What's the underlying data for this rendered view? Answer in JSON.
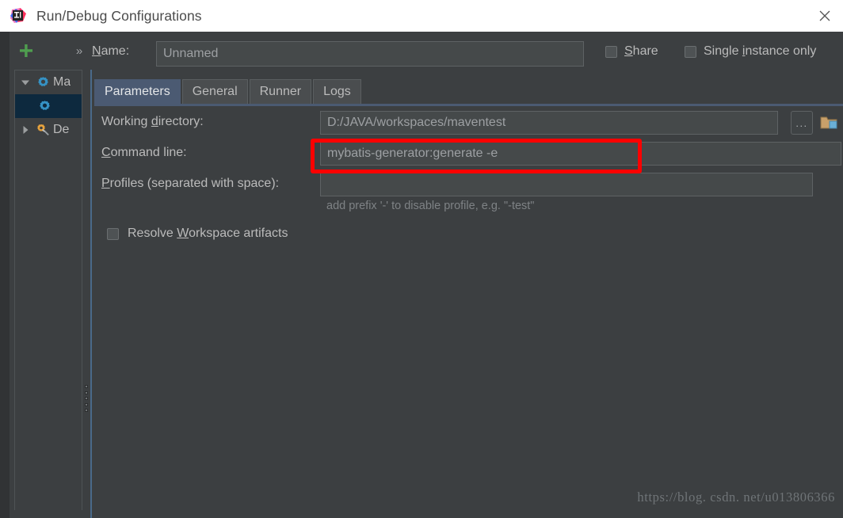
{
  "window": {
    "title": "Run/Debug Configurations",
    "logo_icon": "intellij-idea-logo",
    "close_icon": "close-icon"
  },
  "toolbar": {
    "add_icon": "plus-icon",
    "more_icon": "chevron-double-right-icon",
    "name_label_prefix": "N",
    "name_label_rest": "ame:",
    "name_value": "Unnamed",
    "name_placeholder": "Unnamed",
    "checkboxes": [
      {
        "id": "share",
        "label_prefix": "S",
        "label_rest": "hare",
        "checked": false
      },
      {
        "id": "single-instance",
        "label_prefix": "Single ",
        "label_mn": "i",
        "label_rest": "nstance only",
        "checked": false
      }
    ]
  },
  "sidebar": {
    "items": [
      {
        "id": "maven",
        "label": "Ma",
        "icon": "gear-icon",
        "twisty": "triangle-down-icon",
        "expanded": true,
        "selected": false,
        "indent": false
      },
      {
        "id": "maven-child",
        "label": "",
        "icon": "gear-icon",
        "twisty": "",
        "expanded": false,
        "selected": true,
        "indent": true
      },
      {
        "id": "defaults",
        "label": "De",
        "icon": "wrench-gear-icon",
        "twisty": "triangle-right-icon",
        "expanded": false,
        "selected": false,
        "indent": false
      }
    ],
    "splitter_handle": "splitter-dots"
  },
  "tabs": [
    {
      "id": "parameters",
      "label": "Parameters",
      "active": true
    },
    {
      "id": "general",
      "label": "General",
      "active": false
    },
    {
      "id": "runner",
      "label": "Runner",
      "active": false
    },
    {
      "id": "logs",
      "label": "Logs",
      "active": false
    }
  ],
  "form": {
    "working_directory": {
      "label_a": "Working ",
      "label_mn": "d",
      "label_b": "irectory:",
      "value": "D:/JAVA/workspaces/maventest",
      "browse_label": "...",
      "folder_icon": "folder-icon"
    },
    "command_line": {
      "label_mn": "C",
      "label_b": "ommand line:",
      "value": "mybatis-generator:generate -e"
    },
    "profiles": {
      "label_mn": "P",
      "label_b": "rofiles (separated with space):",
      "value": "",
      "hint": "add prefix '-' to disable profile, e.g. \"-test\""
    },
    "resolve_workspace": {
      "label_a": "Resolve ",
      "label_mn": "W",
      "label_b": "orkspace artifacts",
      "checked": false
    }
  },
  "annotation": {
    "color": "#fe0000",
    "target": "command-line-input"
  },
  "watermark": {
    "text": "https://blog. csdn. net/u013806366"
  },
  "colors": {
    "window_bg": "#3c3f41",
    "titlebar_bg": "#ffffff",
    "field_bg": "#45494a",
    "tab_active_bg": "#4b5a72",
    "tree_selected_bg": "#0d293e",
    "accent_green": "#4a9c4a",
    "annotation_red": "#fe0000"
  }
}
